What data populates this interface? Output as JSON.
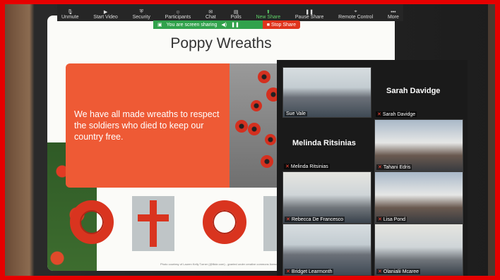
{
  "toolbar": {
    "items": [
      {
        "label": "Unmute",
        "icon": "microphone-muted-icon"
      },
      {
        "label": "Start Video",
        "icon": "video-icon"
      },
      {
        "label": "Security",
        "icon": "shield-icon"
      },
      {
        "label": "Participants",
        "icon": "people-icon"
      },
      {
        "label": "Chat",
        "icon": "chat-icon"
      },
      {
        "label": "Polls",
        "icon": "poll-icon"
      },
      {
        "label": "New Share",
        "icon": "share-icon"
      },
      {
        "label": "Pause Share",
        "icon": "pause-icon"
      },
      {
        "label": "Remote Control",
        "icon": "remote-icon"
      },
      {
        "label": "More",
        "icon": "more-icon"
      }
    ]
  },
  "share_bar": {
    "status": "You are screen sharing",
    "stop_label": "Stop Share"
  },
  "slide": {
    "title": "Poppy Wreaths",
    "body": "We have all made wreaths to respect the soldiers who died to keep our country free.",
    "credit": "Photo courtesy of Lauren Kelly Turner (@flickr.com) - granted under creative commons licence - attribution"
  },
  "gallery": {
    "big_names": [
      "Sarah Davidge",
      "Melinda Ritsinias"
    ],
    "tiles": [
      "Sue Vale",
      "Sarah Davidge",
      "Tahani Edris",
      "Melinda Ritsinias",
      "Rebecca De Francesco",
      "Lisa Pond",
      "Bridget Learmonth",
      "Olanialii Mcaree"
    ]
  },
  "colors": {
    "frame": "#e60000",
    "slide_orange": "#ee5a35",
    "share_green": "#31a24c",
    "stop_red": "#e0341c"
  }
}
